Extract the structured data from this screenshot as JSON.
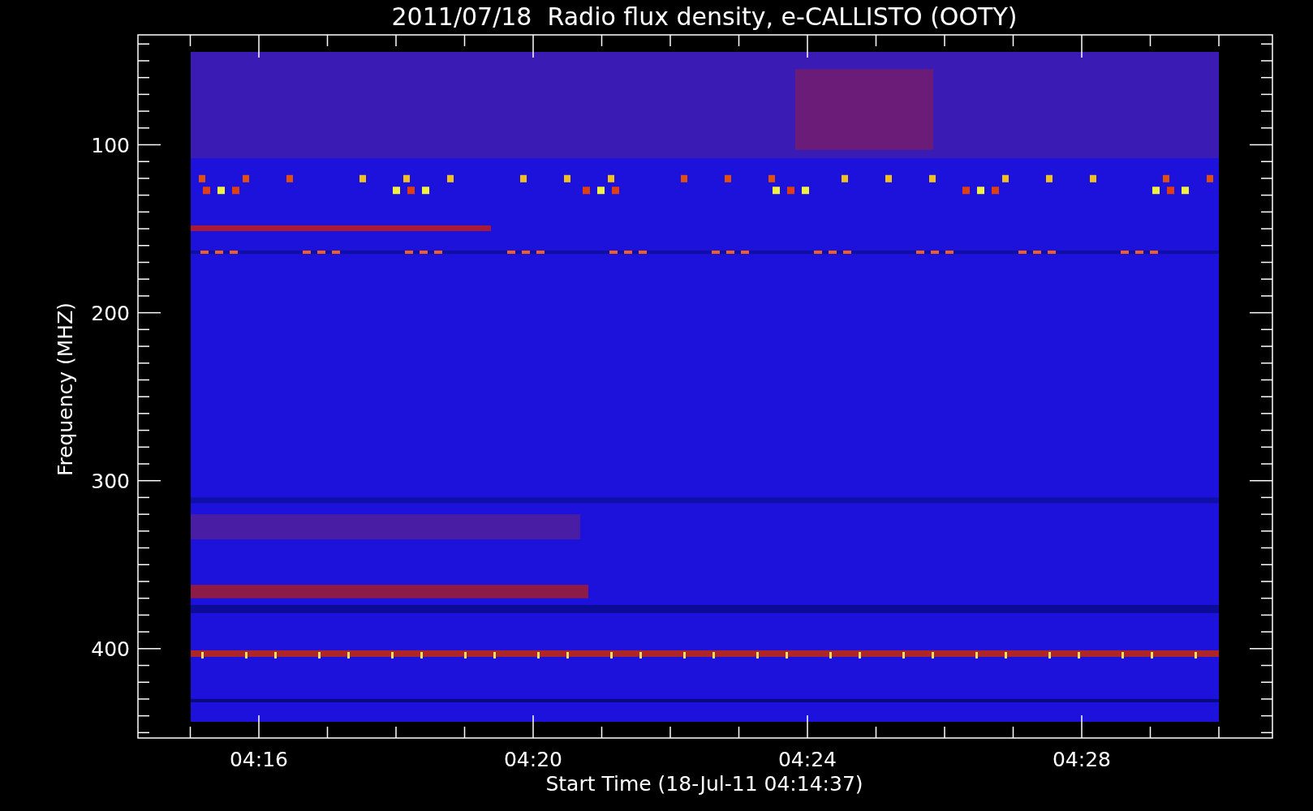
{
  "chart": {
    "title": "2011/07/18  Radio flux density, e-CALLISTO (OOTY)",
    "ylabel": "Frequency (MHZ)",
    "xlabel": "Start Time (18-Jul-11 04:14:37)",
    "y_ticks": [
      "100",
      "200",
      "300",
      "400"
    ],
    "x_ticks": [
      "04:16",
      "04:20",
      "04:24",
      "04:28"
    ]
  }
}
